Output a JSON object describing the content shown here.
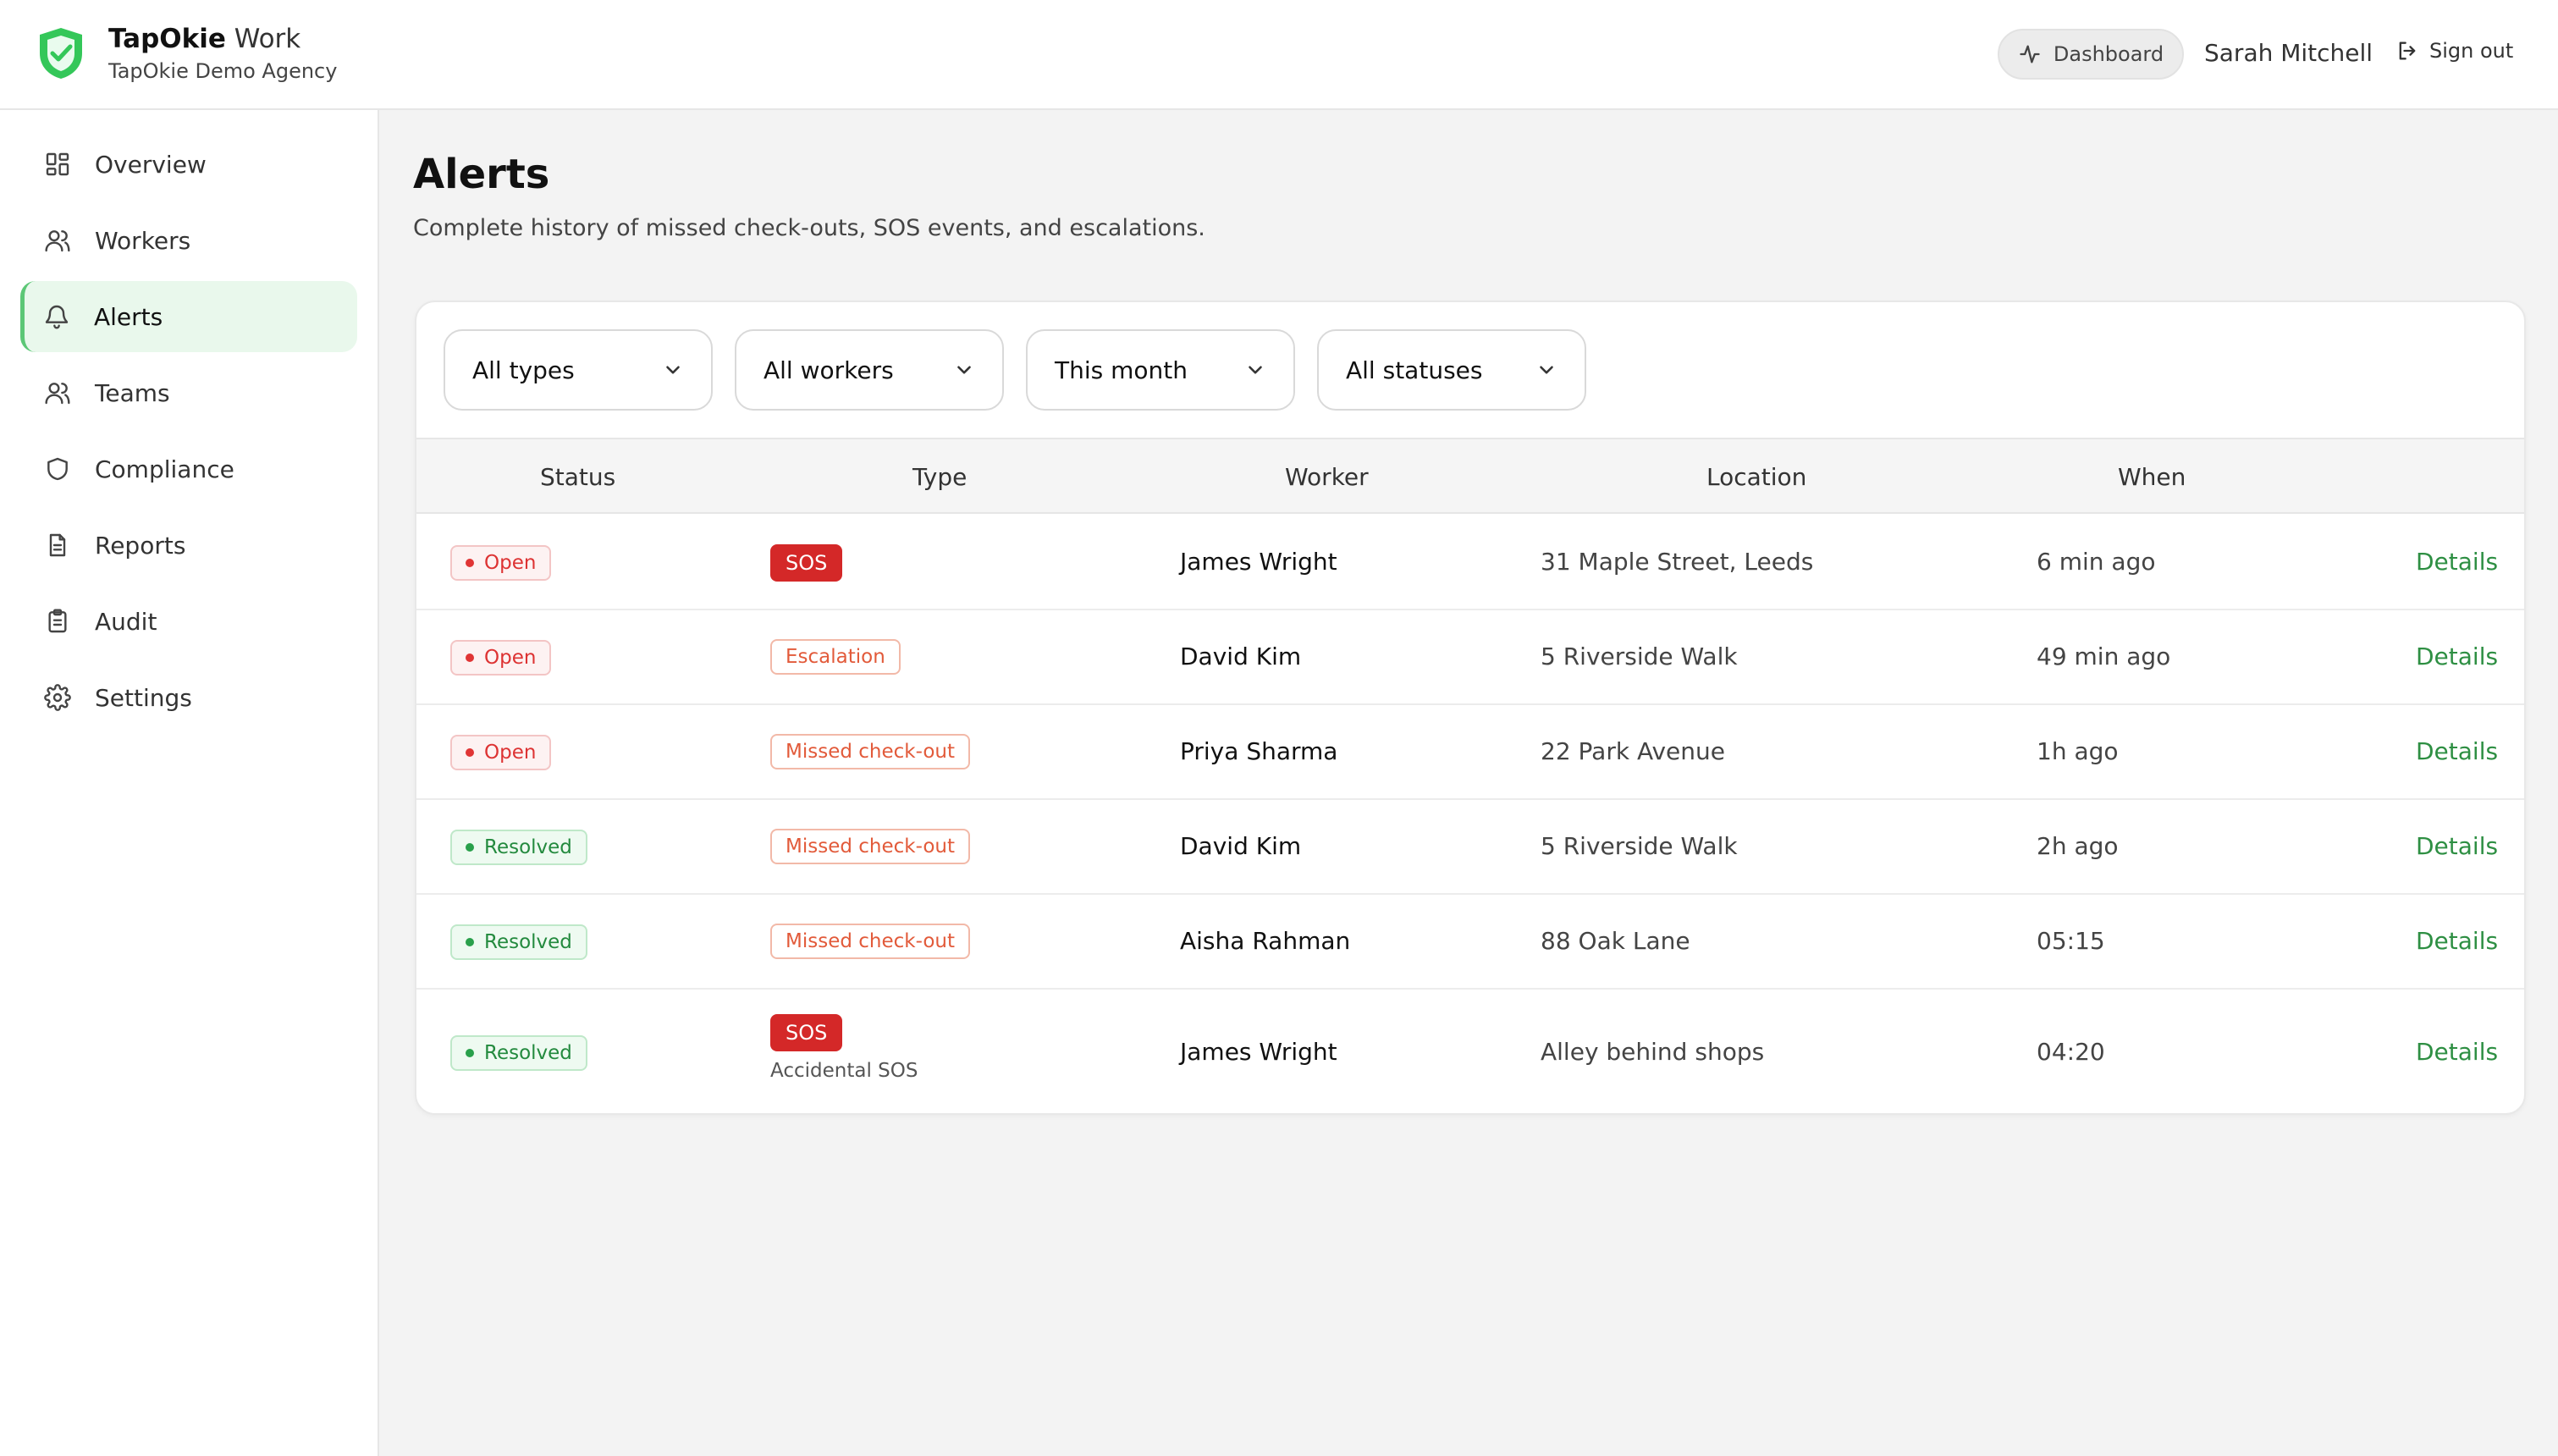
{
  "header": {
    "brand_bold": "TapOkie",
    "brand_light": " Work",
    "org": "TapOkie Demo Agency",
    "dashboard_label": "Dashboard",
    "user_name": "Sarah Mitchell",
    "signout_label": "Sign out",
    "accent": "#34c759"
  },
  "sidebar": {
    "items": [
      {
        "label": "Overview",
        "icon": "grid-icon"
      },
      {
        "label": "Workers",
        "icon": "users-icon"
      },
      {
        "label": "Alerts",
        "icon": "bell-icon",
        "active": true
      },
      {
        "label": "Teams",
        "icon": "team-icon"
      },
      {
        "label": "Compliance",
        "icon": "shield-icon"
      },
      {
        "label": "Reports",
        "icon": "file-icon"
      },
      {
        "label": "Audit",
        "icon": "clipboard-icon"
      },
      {
        "label": "Settings",
        "icon": "gear-icon"
      }
    ]
  },
  "main": {
    "title": "Alerts",
    "description": "Complete history of missed check-outs, SOS events, and escalations."
  },
  "filters": {
    "type": "All types",
    "worker": "All workers",
    "period": "This month",
    "status": "All statuses"
  },
  "table": {
    "headers": {
      "status": "Status",
      "type": "Type",
      "worker": "Worker",
      "location": "Location",
      "when": "When"
    },
    "rows": [
      {
        "status": "Open",
        "type": "SOS",
        "worker": "James Wright",
        "location": "31 Maple Street, Leeds",
        "when": "6 min ago",
        "action": "Details"
      },
      {
        "status": "Open",
        "type": "Escalation",
        "worker": "David Kim",
        "location": "5 Riverside Walk",
        "when": "49 min ago",
        "action": "Details"
      },
      {
        "status": "Open",
        "type": "Missed check-out",
        "worker": "Priya Sharma",
        "location": "22 Park Avenue",
        "when": "1h ago",
        "action": "Details"
      },
      {
        "status": "Resolved",
        "type": "Missed check-out",
        "worker": "David Kim",
        "location": "5 Riverside Walk",
        "when": "2h ago",
        "action": "Details"
      },
      {
        "status": "Resolved",
        "type": "Missed check-out",
        "worker": "Aisha Rahman",
        "location": "88 Oak Lane",
        "when": "05:15",
        "action": "Details"
      },
      {
        "status": "Resolved",
        "type": "SOS",
        "note": "Accidental SOS",
        "worker": "James Wright",
        "location": "Alley behind shops",
        "when": "04:20",
        "action": "Details"
      }
    ]
  }
}
